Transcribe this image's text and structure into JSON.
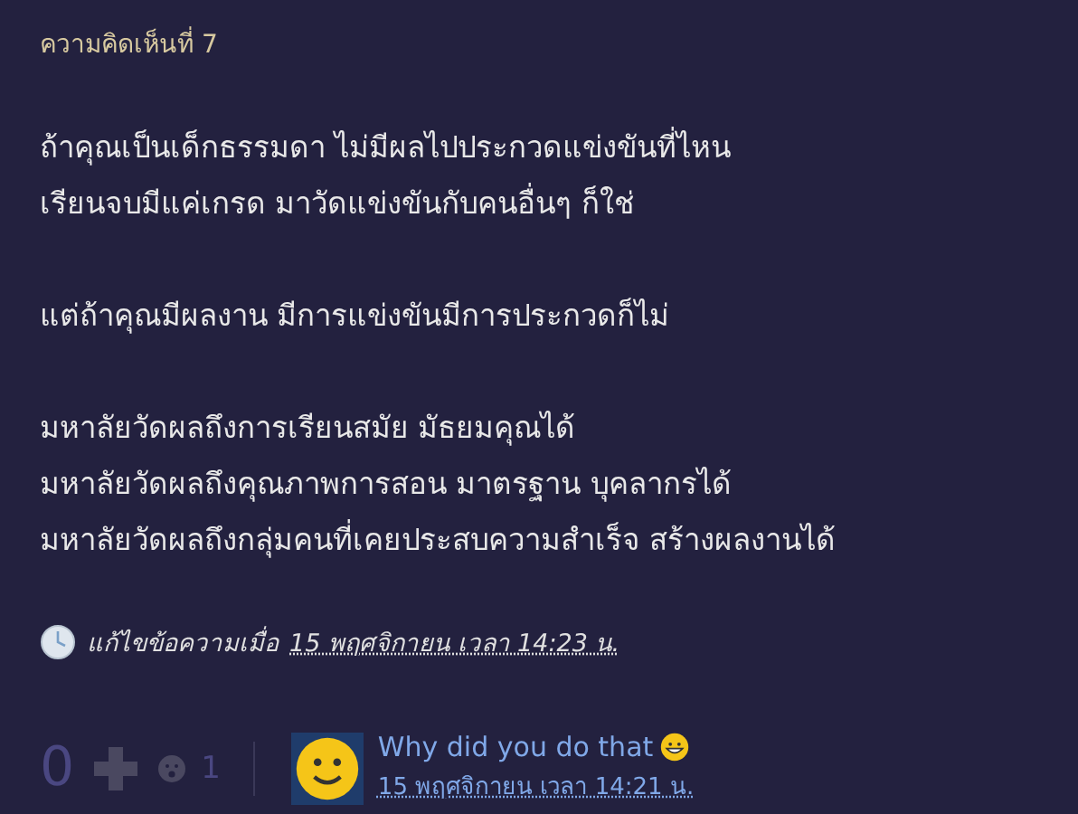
{
  "comment_header": "ความคิดเห็นที่ 7",
  "paragraphs": [
    [
      "ถ้าคุณเป็นเด็กธรรมดา ไม่มีผลไปประกวดแข่งขันที่ไหน",
      "เรียนจบมีแค่เกรด มาวัดแข่งขันกับคนอื่นๆ ก็ใช่"
    ],
    [
      "แต่ถ้าคุณมีผลงาน มีการแข่งขันมีการประกวดก็ไม่"
    ],
    [
      "มหาลัยวัดผลถึงการเรียนสมัย มัธยมคุณได้",
      "มหาลัยวัดผลถึงคุณภาพการสอน มาตรฐาน บุคลากรได้",
      "มหาลัยวัดผลถึงกลุ่มคนที่เคยประสบความสำเร็จ สร้างผลงานได้"
    ]
  ],
  "edited": {
    "label": "แก้ไขข้อความเมื่อ",
    "date": "15 พฤศจิกายน เวลา 14:23 น."
  },
  "footer": {
    "votes": "0",
    "emotion_count": "1",
    "author": "Why did you do that",
    "date": "15 พฤศจิกายน เวลา 14:21 น."
  }
}
